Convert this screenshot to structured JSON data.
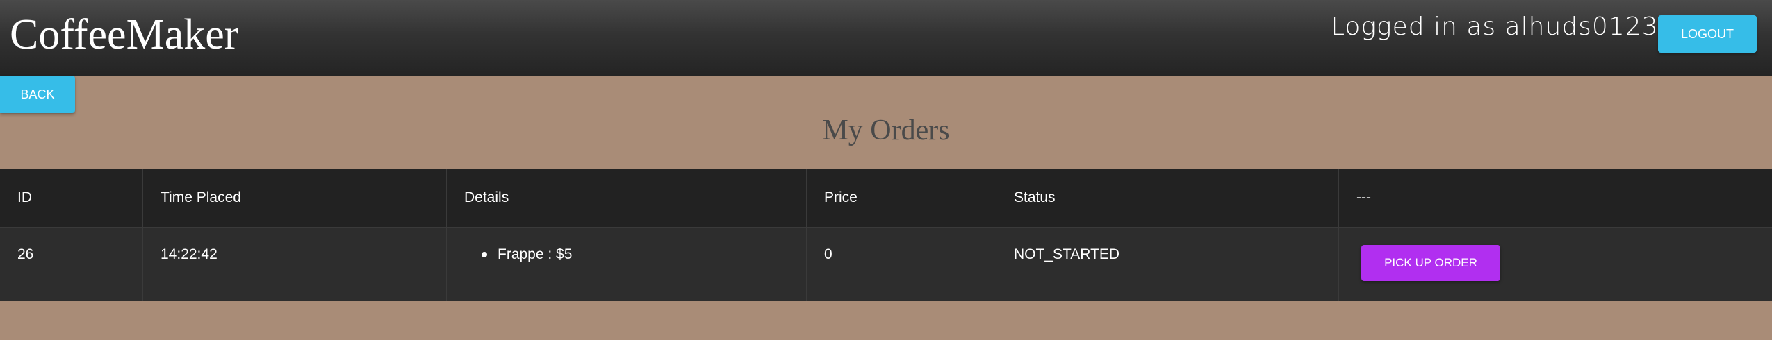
{
  "header": {
    "brand": "CoffeeMaker",
    "logged_in_text": "Logged in as alhuds0123",
    "logout_label": "LOGOUT"
  },
  "nav": {
    "back_label": "BACK"
  },
  "page": {
    "title": "My Orders"
  },
  "orders_table": {
    "columns": [
      "ID",
      "Time Placed",
      "Details",
      "Price",
      "Status",
      "---"
    ],
    "rows": [
      {
        "id": "26",
        "time_placed": "14:22:42",
        "details": [
          "Frappe : $5"
        ],
        "price": "0",
        "status": "NOT_STARTED",
        "action_label": "PICK UP ORDER"
      }
    ]
  },
  "colors": {
    "background": "#a98c77",
    "header_bg": "#2f2f2f",
    "primary_button": "#36bde8",
    "accent_button": "#b12ff0",
    "table_header_bg": "#222222",
    "table_row_bg": "#2d2d2d"
  }
}
